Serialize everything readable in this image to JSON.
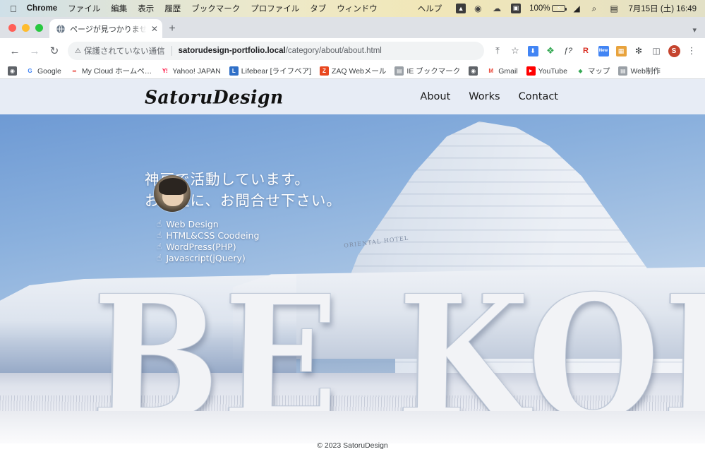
{
  "mac_menu": {
    "apple_icon": "apple-icon",
    "items": [
      {
        "label": "Chrome",
        "bold": true
      },
      {
        "label": "ファイル",
        "bold": false
      },
      {
        "label": "編集",
        "bold": false
      },
      {
        "label": "表示",
        "bold": false
      },
      {
        "label": "履歴",
        "bold": false
      },
      {
        "label": "ブックマーク",
        "bold": false
      },
      {
        "label": "プロファイル",
        "bold": false
      },
      {
        "label": "タブ",
        "bold": false
      },
      {
        "label": "ウィンドウ",
        "bold": false
      }
    ],
    "help_label": "ヘルプ",
    "battery_percent": "100%",
    "datetime": "7月15日 (土)  16:49",
    "tray_icons": [
      "triangle-warning-icon",
      "eye-privacy-icon",
      "cloud-icon",
      "screenshot-icon",
      "wifi-icon",
      "spotlight-search-icon",
      "control-center-icon"
    ]
  },
  "browser": {
    "tab": {
      "title": "ページが見つかりませんでした –",
      "favicon": "globe-icon",
      "close_icon": "close-icon"
    },
    "new_tab_icon": "plus-icon",
    "tab_list_icon": "chevron-down-icon",
    "nav": {
      "back_icon": "arrow-left-icon",
      "forward_icon": "arrow-right-icon",
      "reload_icon": "reload-icon"
    },
    "omnibox": {
      "security_label": "保護されていない通信",
      "security_icon": "warning-triangle-icon",
      "url_host": "satorudesign-portfolio.local",
      "url_path": "/category/about/about.html"
    },
    "toolbar_icons": [
      {
        "name": "share-icon",
        "glyph": "⇪",
        "color": "#5f6368",
        "bg": "transparent"
      },
      {
        "name": "bookmark-star-icon",
        "glyph": "☆",
        "color": "#5f6368",
        "bg": "transparent"
      },
      {
        "name": "downloader-extension-icon",
        "glyph": "⬇",
        "color": "#ffffff",
        "bg": "#4285f4"
      },
      {
        "name": "colorzilla-extension-icon",
        "glyph": "◉",
        "color": "#ffffff",
        "bg": "transparent"
      },
      {
        "name": "fontface-ninja-extension-icon",
        "glyph": "ƒ?",
        "color": "#3c4043",
        "bg": "transparent"
      },
      {
        "name": "ruler-extension-icon",
        "glyph": "R",
        "color": "#d93025",
        "bg": "transparent"
      },
      {
        "name": "screenshot-extension-icon",
        "glyph": "New",
        "color": "#ffffff",
        "bg": "#4285f4"
      },
      {
        "name": "image-extension-icon",
        "glyph": "▦",
        "color": "#e8a33d",
        "bg": "transparent"
      },
      {
        "name": "extensions-puzzle-icon",
        "glyph": "✳",
        "color": "#3c4043",
        "bg": "transparent"
      },
      {
        "name": "side-panel-icon",
        "glyph": "▣",
        "color": "#5f6368",
        "bg": "transparent"
      }
    ],
    "profile_initial": "S",
    "menu_icon": "three-dot-menu-icon",
    "bookmarks": [
      {
        "label": "",
        "icon_text": "◍",
        "icon_bg": "#5f6368"
      },
      {
        "label": "Google",
        "icon_text": "G",
        "icon_bg": "#ffffff",
        "icon_color": "#4285f4"
      },
      {
        "label": "My Cloud ホームペ…",
        "icon_text": "∞",
        "icon_bg": "#ffffff",
        "icon_color": "#e8473f"
      },
      {
        "label": "Yahoo! JAPAN",
        "icon_text": "Y!",
        "icon_bg": "#ffffff",
        "icon_color": "#ff0033"
      },
      {
        "label": "Lifebear [ライフベア]",
        "icon_text": "L",
        "icon_bg": "#2f6fc7"
      },
      {
        "label": "ZAQ Webメール",
        "icon_text": "Z",
        "icon_bg": "#e8471f"
      },
      {
        "label": "IE ブックマーク",
        "icon_text": "▤",
        "icon_bg": "#9aa0a6"
      },
      {
        "label": "",
        "icon_text": "◍",
        "icon_bg": "#5f6368"
      },
      {
        "label": "Gmail",
        "icon_text": "M",
        "icon_bg": "#ffffff",
        "icon_color": "#ea4335"
      },
      {
        "label": "YouTube",
        "icon_text": "▶",
        "icon_bg": "#ff0000"
      },
      {
        "label": "マップ",
        "icon_text": "◆",
        "icon_bg": "#ffffff",
        "icon_color": "#34a853"
      },
      {
        "label": "Web制作",
        "icon_text": "▤",
        "icon_bg": "#9aa0a6"
      }
    ]
  },
  "site": {
    "logo_text": "SatoruDesign",
    "nav": [
      {
        "label": "About"
      },
      {
        "label": "Works"
      },
      {
        "label": "Contact"
      }
    ],
    "hero": {
      "line1": "神戸で活動しています。",
      "line2": "お気軽に、お問合せ下さい。",
      "avatar": "profile-photo",
      "bullet_icon": "pointing-hand-icon",
      "bullet_glyph": "☝",
      "skills": [
        {
          "label": "Web Design"
        },
        {
          "label": "HTML&CSS Coodeing"
        },
        {
          "label": "WordPress(PHP)"
        },
        {
          "label": "Javascript(jQuery)"
        }
      ],
      "monument_text": "BE KOBE",
      "building_label": "ORIENTAL HOTEL"
    },
    "footer": {
      "copyright": "© 2023 SatoruDesign"
    }
  }
}
